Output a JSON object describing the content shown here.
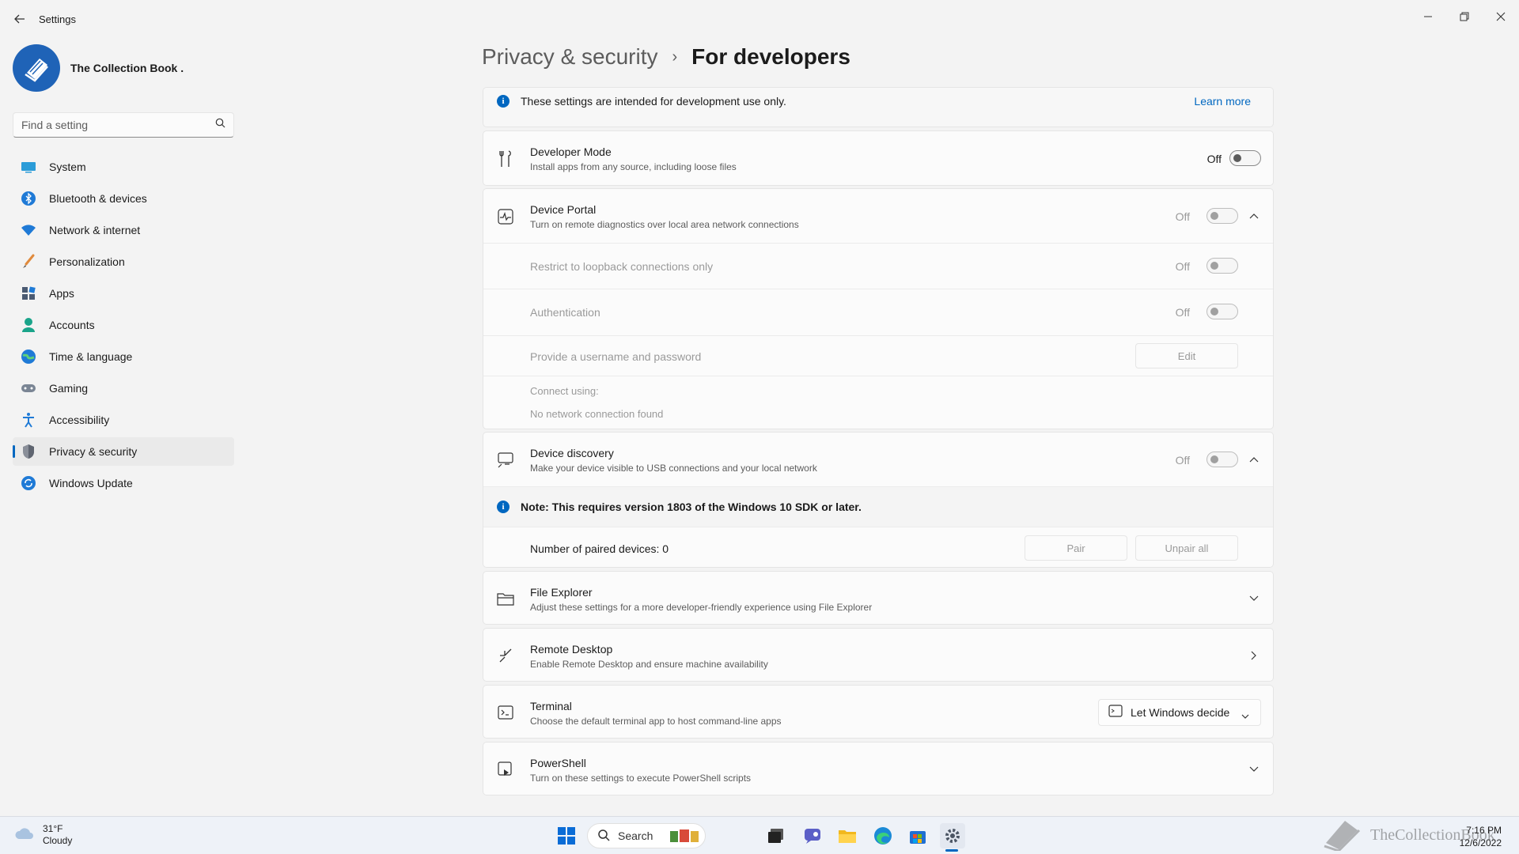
{
  "window": {
    "title": "Settings"
  },
  "profile": {
    "name": "The Collection Book ."
  },
  "search": {
    "placeholder": "Find a setting"
  },
  "sidebar": {
    "items": [
      {
        "label": "System",
        "icon": "system-icon"
      },
      {
        "label": "Bluetooth & devices",
        "icon": "bluetooth-icon"
      },
      {
        "label": "Network & internet",
        "icon": "wifi-icon"
      },
      {
        "label": "Personalization",
        "icon": "brush-icon"
      },
      {
        "label": "Apps",
        "icon": "apps-icon"
      },
      {
        "label": "Accounts",
        "icon": "person-icon"
      },
      {
        "label": "Time & language",
        "icon": "globe-clock-icon"
      },
      {
        "label": "Gaming",
        "icon": "gamepad-icon"
      },
      {
        "label": "Accessibility",
        "icon": "accessibility-icon"
      },
      {
        "label": "Privacy & security",
        "icon": "shield-icon",
        "active": true
      },
      {
        "label": "Windows Update",
        "icon": "update-icon"
      }
    ]
  },
  "breadcrumb": {
    "parent": "Privacy & security",
    "separator": "›",
    "current": "For developers"
  },
  "banner": {
    "text": "These settings are intended for development use only.",
    "link": "Learn more"
  },
  "developer_mode": {
    "title": "Developer Mode",
    "desc": "Install apps from any source, including loose files",
    "state": "Off"
  },
  "device_portal": {
    "title": "Device Portal",
    "desc": "Turn on remote diagnostics over local area network connections",
    "state": "Off",
    "loopback": {
      "label": "Restrict to loopback connections only",
      "state": "Off"
    },
    "auth": {
      "label": "Authentication",
      "state": "Off"
    },
    "credentials": {
      "label": "Provide a username and password",
      "button": "Edit"
    },
    "connect": {
      "label": "Connect using:",
      "value": "No network connection found"
    }
  },
  "device_discovery": {
    "title": "Device discovery",
    "desc": "Make your device visible to USB connections and your local network",
    "state": "Off",
    "note": "Note: This requires version 1803 of the Windows 10 SDK or later.",
    "paired": "Number of paired devices: 0",
    "pair_button": "Pair",
    "unpair_button": "Unpair all"
  },
  "file_explorer": {
    "title": "File Explorer",
    "desc": "Adjust these settings for a more developer-friendly experience using File Explorer"
  },
  "remote_desktop": {
    "title": "Remote Desktop",
    "desc": "Enable Remote Desktop and ensure machine availability"
  },
  "terminal": {
    "title": "Terminal",
    "desc": "Choose the default terminal app to host command-line apps",
    "selected": "Let Windows decide"
  },
  "powershell": {
    "title": "PowerShell",
    "desc": "Turn on these settings to execute PowerShell scripts"
  },
  "taskbar": {
    "weather_temp": "31°F",
    "weather_cond": "Cloudy",
    "search_label": "Search",
    "time": "7:16 PM",
    "date": "12/6/2022"
  },
  "watermark": {
    "text": "TheCollectionBook"
  },
  "colors": {
    "accent": "#0067c0",
    "background": "#f3f3f3",
    "card": "#fbfbfb"
  }
}
